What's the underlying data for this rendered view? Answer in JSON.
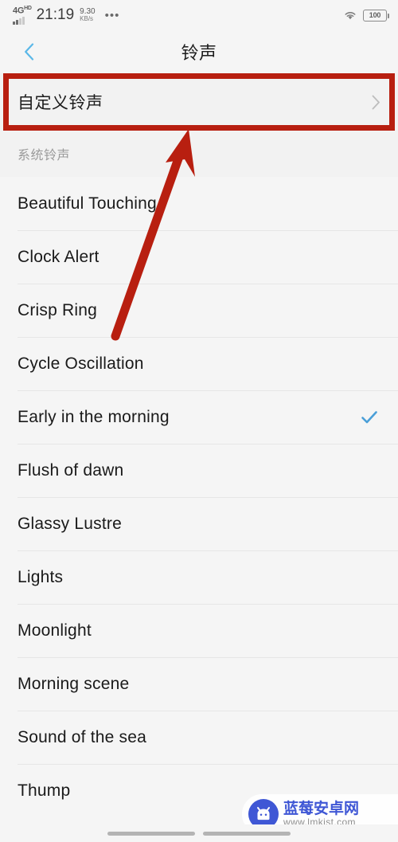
{
  "status_bar": {
    "network_type": "4G",
    "network_type_sup": "HD",
    "time": "21:19",
    "net_speed_value": "9.30",
    "net_speed_unit": "KB/s",
    "more_dots": "•••",
    "wifi_icon": "wifi-icon",
    "battery_level": "100"
  },
  "app_bar": {
    "back_icon": "chevron-left-icon",
    "title": "铃声"
  },
  "custom_ringtone": {
    "label": "自定义铃声",
    "chevron_icon": "chevron-right-icon"
  },
  "annotation": {
    "box_color": "#b81f10",
    "arrow_color": "#b81f10"
  },
  "section": {
    "header": "系统铃声"
  },
  "ringtones": [
    {
      "name": "Beautiful Touching",
      "selected": false
    },
    {
      "name": "Clock Alert",
      "selected": false
    },
    {
      "name": "Crisp Ring",
      "selected": false
    },
    {
      "name": "Cycle Oscillation",
      "selected": false
    },
    {
      "name": "Early in the morning",
      "selected": true
    },
    {
      "name": "Flush of dawn",
      "selected": false
    },
    {
      "name": "Glassy Lustre",
      "selected": false
    },
    {
      "name": "Lights",
      "selected": false
    },
    {
      "name": "Moonlight",
      "selected": false
    },
    {
      "name": "Morning scene",
      "selected": false
    },
    {
      "name": "Sound of the sea",
      "selected": false
    },
    {
      "name": "Thump",
      "selected": false
    }
  ],
  "colors": {
    "accent_check": "#4a9fd8",
    "back_chevron": "#5bb8e8",
    "page_bg": "#f5f5f5",
    "watermark_blue": "#3a52d4"
  },
  "watermark": {
    "brand_cn": "蓝莓安卓网",
    "url": "www.lmkjst.com",
    "logo_icon": "android-robot-icon"
  }
}
